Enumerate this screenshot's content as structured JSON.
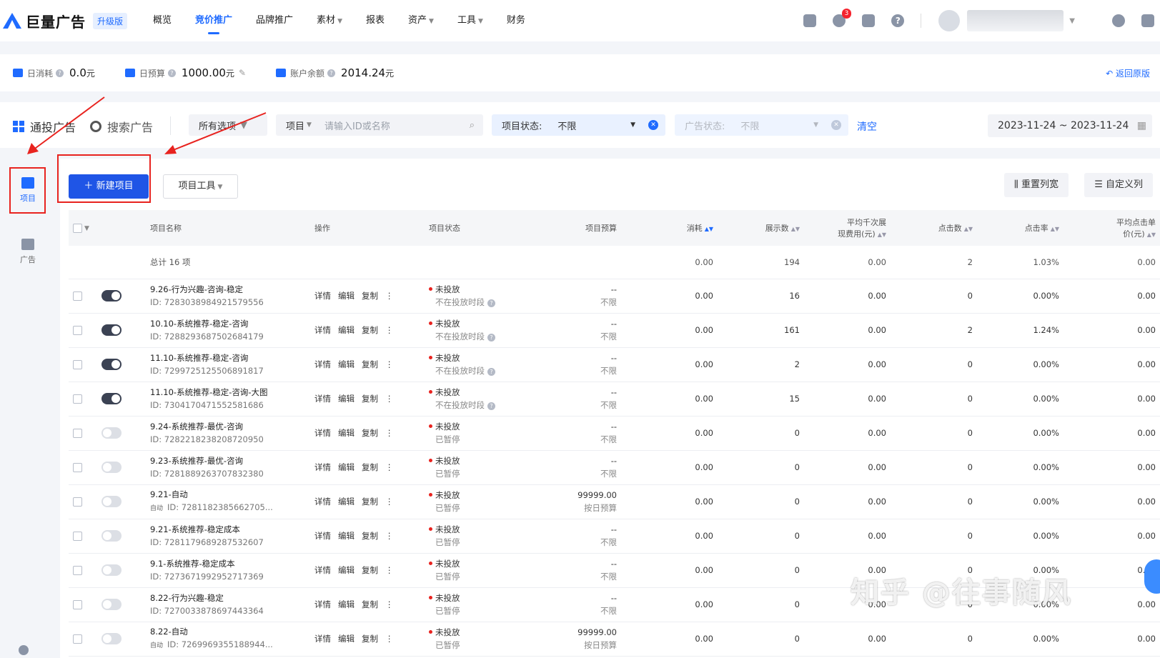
{
  "app": {
    "logo_text": "巨量广告",
    "upgrade_badge": "升级版",
    "nav": [
      "概览",
      "竞价推广",
      "品牌推广",
      "素材",
      "报表",
      "资产",
      "工具",
      "财务"
    ],
    "nav_active_index": 1,
    "notification_count": "3",
    "help_icon_text": "?"
  },
  "account": {
    "daily_spend_label": "日消耗",
    "daily_spend_value": "0.0",
    "daily_spend_unit": "元",
    "daily_budget_label": "日预算",
    "daily_budget_value": "1000.00",
    "daily_budget_unit": "元",
    "balance_label": "账户余额",
    "balance_value": "2014.24",
    "balance_unit": "元",
    "back_link": "返回原版"
  },
  "filters": {
    "tab_general": "通投广告",
    "tab_search": "搜索广告",
    "all_options": "所有选项",
    "search_type": "项目",
    "search_placeholder": "请输入ID或名称",
    "project_status_label": "项目状态:",
    "project_status_value": "不限",
    "ad_status_label": "广告状态:",
    "ad_status_value": "不限",
    "clear": "清空",
    "date_range": "2023-11-24   ~ 2023-11-24"
  },
  "sidebar": {
    "project": "项目",
    "ad": "广告"
  },
  "toolbar": {
    "new_project": "新建项目",
    "project_tools": "项目工具",
    "reset_width": "重置列宽",
    "custom_columns": "自定义列"
  },
  "table": {
    "headers": {
      "name": "项目名称",
      "ops": "操作",
      "status": "项目状态",
      "budget": "项目预算",
      "cost": "消耗",
      "impressions": "展示数",
      "cpm_line1": "平均千次展",
      "cpm_line2": "现费用(元)",
      "clicks": "点击数",
      "ctr": "点击率",
      "cpc_line1": "平均点击单",
      "cpc_line2": "价(元)"
    },
    "total": {
      "label": "总计 16 项",
      "cost": "0.00",
      "impressions": "194",
      "cpm": "0.00",
      "clicks": "2",
      "ctr": "1.03%",
      "cpc": "0.00"
    },
    "op_labels": [
      "详情",
      "编辑",
      "复制",
      "⋮"
    ],
    "rows": [
      {
        "on": true,
        "name": "9.26-行为兴趣-咨询-稳定",
        "auto": "",
        "id": "ID: 7283038984921579556",
        "status": "未投放",
        "sub": "不在投放时段",
        "b1": "--",
        "b2": "不限",
        "cost": "0.00",
        "imp": "16",
        "cpm": "0.00",
        "clk": "0",
        "ctr": "0.00%",
        "cpc": "0.00"
      },
      {
        "on": true,
        "name": "10.10-系统推荐-稳定-咨询",
        "auto": "",
        "id": "ID: 7288293687502684179",
        "status": "未投放",
        "sub": "不在投放时段",
        "b1": "--",
        "b2": "不限",
        "cost": "0.00",
        "imp": "161",
        "cpm": "0.00",
        "clk": "2",
        "ctr": "1.24%",
        "cpc": "0.00"
      },
      {
        "on": true,
        "name": "11.10-系统推荐-稳定-咨询",
        "auto": "",
        "id": "ID: 7299725125506891817",
        "status": "未投放",
        "sub": "不在投放时段",
        "b1": "--",
        "b2": "不限",
        "cost": "0.00",
        "imp": "2",
        "cpm": "0.00",
        "clk": "0",
        "ctr": "0.00%",
        "cpc": "0.00"
      },
      {
        "on": true,
        "name": "11.10-系统推荐-稳定-咨询-大图",
        "auto": "",
        "id": "ID: 7304170471552581686",
        "status": "未投放",
        "sub": "不在投放时段",
        "b1": "--",
        "b2": "不限",
        "cost": "0.00",
        "imp": "15",
        "cpm": "0.00",
        "clk": "0",
        "ctr": "0.00%",
        "cpc": "0.00"
      },
      {
        "on": false,
        "name": "9.24-系统推荐-最优-咨询",
        "auto": "",
        "id": "ID: 7282218238208720950",
        "status": "未投放",
        "sub": "已暂停",
        "b1": "--",
        "b2": "不限",
        "cost": "0.00",
        "imp": "0",
        "cpm": "0.00",
        "clk": "0",
        "ctr": "0.00%",
        "cpc": "0.00"
      },
      {
        "on": false,
        "name": "9.23-系统推荐-最优-咨询",
        "auto": "",
        "id": "ID: 7281889263707832380",
        "status": "未投放",
        "sub": "已暂停",
        "b1": "--",
        "b2": "不限",
        "cost": "0.00",
        "imp": "0",
        "cpm": "0.00",
        "clk": "0",
        "ctr": "0.00%",
        "cpc": "0.00"
      },
      {
        "on": false,
        "name": "9.21-自动",
        "auto": "自动",
        "id": "ID: 7281182385662705...",
        "status": "未投放",
        "sub": "已暂停",
        "b1": "99999.00",
        "b2": "按日预算",
        "cost": "0.00",
        "imp": "0",
        "cpm": "0.00",
        "clk": "0",
        "ctr": "0.00%",
        "cpc": "0.00"
      },
      {
        "on": false,
        "name": "9.21-系统推荐-稳定成本",
        "auto": "",
        "id": "ID: 7281179689287532607",
        "status": "未投放",
        "sub": "已暂停",
        "b1": "--",
        "b2": "不限",
        "cost": "0.00",
        "imp": "0",
        "cpm": "0.00",
        "clk": "0",
        "ctr": "0.00%",
        "cpc": "0.00"
      },
      {
        "on": false,
        "name": "9.1-系统推荐-稳定成本",
        "auto": "",
        "id": "ID: 7273671992952717369",
        "status": "未投放",
        "sub": "已暂停",
        "b1": "--",
        "b2": "不限",
        "cost": "0.00",
        "imp": "0",
        "cpm": "0.00",
        "clk": "0",
        "ctr": "0.00%",
        "cpc": "0.00"
      },
      {
        "on": false,
        "name": "8.22-行为兴趣-稳定",
        "auto": "",
        "id": "ID: 7270033878697443364",
        "status": "未投放",
        "sub": "已暂停",
        "b1": "--",
        "b2": "不限",
        "cost": "0.00",
        "imp": "0",
        "cpm": "0.00",
        "clk": "0",
        "ctr": "0.00%",
        "cpc": "0.00"
      },
      {
        "on": false,
        "name": "8.22-自动",
        "auto": "自动",
        "id": "ID: 7269969355188944...",
        "status": "未投放",
        "sub": "已暂停",
        "b1": "99999.00",
        "b2": "按日预算",
        "cost": "0.00",
        "imp": "0",
        "cpm": "0.00",
        "clk": "0",
        "ctr": "0.00%",
        "cpc": "0.00"
      }
    ]
  },
  "watermark": "知乎 @往事随风",
  "colors": {
    "accent": "#1f6bff",
    "primary_button": "#1f55e6",
    "annotation_red": "#e8231f",
    "status_dot": "#e8231f"
  }
}
